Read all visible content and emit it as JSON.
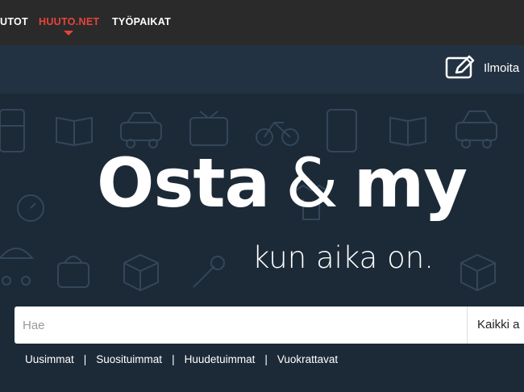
{
  "topnav": {
    "items": [
      {
        "label": "UTOT",
        "active": false
      },
      {
        "label": "HUUTO.NET",
        "active": true
      },
      {
        "label": "TYÖPAIKAT",
        "active": false
      }
    ],
    "active_color": "#e8443a"
  },
  "subbar": {
    "post_label": "Ilmoita",
    "post_icon": "pencil-square-icon"
  },
  "hero": {
    "headline_word1": "Osta",
    "headline_amp": "&",
    "headline_word2": "my",
    "tagline": "kun aika on."
  },
  "search": {
    "placeholder": "Hae",
    "value": "",
    "category": "Kaikki a"
  },
  "quick_links": [
    "Uusimmat",
    "Suosituimmat",
    "Huudetuimmat",
    "Vuokrattavat"
  ],
  "quick_link_separator": "|",
  "colors": {
    "topbar": "#2a2a2a",
    "subbar": "#233242",
    "hero": "#1c2a37",
    "accent": "#e8443a"
  }
}
